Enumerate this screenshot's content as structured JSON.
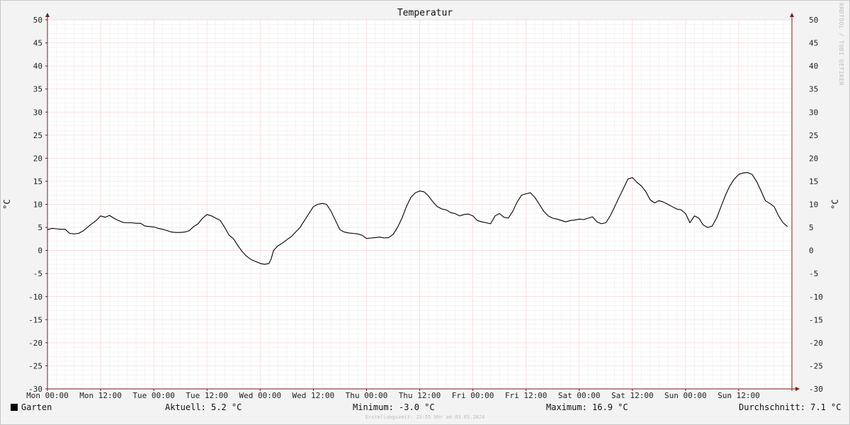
{
  "chart_data": {
    "type": "line",
    "title": "Temperatur",
    "ylabel_left": "°C",
    "ylabel_right": "°C",
    "ylim": [
      -30,
      50
    ],
    "ytick_step": 5,
    "xlim_hours": [
      0,
      168
    ],
    "xtick_labels": [
      "Mon 00:00",
      "Mon 12:00",
      "Tue 00:00",
      "Tue 12:00",
      "Wed 00:00",
      "Wed 12:00",
      "Thu 00:00",
      "Thu 12:00",
      "Fri 00:00",
      "Fri 12:00",
      "Sat 00:00",
      "Sat 12:00",
      "Sun 00:00",
      "Sun 12:00"
    ],
    "grid": true,
    "series": [
      {
        "name": "Garten",
        "color": "#000000",
        "points": [
          [
            0,
            4.5
          ],
          [
            1,
            4.8
          ],
          [
            2,
            4.7
          ],
          [
            3,
            4.6
          ],
          [
            4,
            4.6
          ],
          [
            5,
            3.7
          ],
          [
            6,
            3.6
          ],
          [
            7,
            3.7
          ],
          [
            8,
            4.2
          ],
          [
            9,
            5.0
          ],
          [
            10,
            5.8
          ],
          [
            11,
            6.5
          ],
          [
            12,
            7.5
          ],
          [
            13,
            7.2
          ],
          [
            14,
            7.6
          ],
          [
            15,
            7.0
          ],
          [
            16,
            6.5
          ],
          [
            17,
            6.1
          ],
          [
            18,
            6.0
          ],
          [
            19,
            6.0
          ],
          [
            20,
            5.9
          ],
          [
            21,
            5.9
          ],
          [
            22,
            5.3
          ],
          [
            23,
            5.2
          ],
          [
            24,
            5.1
          ],
          [
            25,
            4.8
          ],
          [
            26,
            4.6
          ],
          [
            27,
            4.3
          ],
          [
            28,
            4.0
          ],
          [
            29,
            3.9
          ],
          [
            30,
            3.9
          ],
          [
            31,
            4.0
          ],
          [
            32,
            4.3
          ],
          [
            33,
            5.2
          ],
          [
            34,
            5.8
          ],
          [
            35,
            7.0
          ],
          [
            36,
            7.8
          ],
          [
            37,
            7.5
          ],
          [
            38,
            7.0
          ],
          [
            39,
            6.5
          ],
          [
            40,
            5.0
          ],
          [
            41,
            3.3
          ],
          [
            42,
            2.5
          ],
          [
            43,
            1.0
          ],
          [
            44,
            -0.3
          ],
          [
            45,
            -1.3
          ],
          [
            46,
            -2.0
          ],
          [
            47,
            -2.4
          ],
          [
            48,
            -2.8
          ],
          [
            49,
            -3.0
          ],
          [
            50,
            -2.8
          ],
          [
            50.5,
            -1.8
          ],
          [
            51,
            0.0
          ],
          [
            52,
            1.0
          ],
          [
            53,
            1.6
          ],
          [
            54,
            2.3
          ],
          [
            55,
            3.0
          ],
          [
            56,
            4.0
          ],
          [
            57,
            5.0
          ],
          [
            58,
            6.5
          ],
          [
            59,
            8.0
          ],
          [
            60,
            9.5
          ],
          [
            61,
            10.0
          ],
          [
            62,
            10.2
          ],
          [
            63,
            10.0
          ],
          [
            64,
            8.5
          ],
          [
            65,
            6.5
          ],
          [
            66,
            4.5
          ],
          [
            67,
            4.0
          ],
          [
            68,
            3.8
          ],
          [
            69,
            3.7
          ],
          [
            70,
            3.6
          ],
          [
            71,
            3.3
          ],
          [
            72,
            2.6
          ],
          [
            73,
            2.7
          ],
          [
            74,
            2.8
          ],
          [
            75,
            2.9
          ],
          [
            76,
            2.7
          ],
          [
            77,
            2.8
          ],
          [
            78,
            3.5
          ],
          [
            79,
            5.0
          ],
          [
            80,
            7.0
          ],
          [
            81,
            9.5
          ],
          [
            82,
            11.5
          ],
          [
            83,
            12.5
          ],
          [
            84,
            12.9
          ],
          [
            85,
            12.7
          ],
          [
            86,
            11.8
          ],
          [
            87,
            10.5
          ],
          [
            88,
            9.5
          ],
          [
            89,
            9.0
          ],
          [
            90,
            8.8
          ],
          [
            91,
            8.2
          ],
          [
            92,
            8.0
          ],
          [
            93,
            7.5
          ],
          [
            94,
            7.8
          ],
          [
            95,
            7.9
          ],
          [
            96,
            7.5
          ],
          [
            97,
            6.5
          ],
          [
            98,
            6.2
          ],
          [
            99,
            6.0
          ],
          [
            100,
            5.8
          ],
          [
            101,
            7.5
          ],
          [
            102,
            8.0
          ],
          [
            103,
            7.2
          ],
          [
            104,
            7.0
          ],
          [
            105,
            8.5
          ],
          [
            106,
            10.5
          ],
          [
            107,
            12.0
          ],
          [
            108,
            12.3
          ],
          [
            109,
            12.5
          ],
          [
            110,
            11.5
          ],
          [
            111,
            10.0
          ],
          [
            112,
            8.5
          ],
          [
            113,
            7.5
          ],
          [
            114,
            7.0
          ],
          [
            115,
            6.8
          ],
          [
            116,
            6.5
          ],
          [
            117,
            6.2
          ],
          [
            118,
            6.5
          ],
          [
            119,
            6.6
          ],
          [
            120,
            6.8
          ],
          [
            121,
            6.7
          ],
          [
            122,
            7.0
          ],
          [
            123,
            7.3
          ],
          [
            124,
            6.2
          ],
          [
            125,
            5.8
          ],
          [
            126,
            6.0
          ],
          [
            127,
            7.5
          ],
          [
            128,
            9.5
          ],
          [
            129,
            11.5
          ],
          [
            130,
            13.5
          ],
          [
            131,
            15.5
          ],
          [
            132,
            15.8
          ],
          [
            133,
            14.8
          ],
          [
            134,
            14.0
          ],
          [
            135,
            12.8
          ],
          [
            136,
            11.0
          ],
          [
            137,
            10.3
          ],
          [
            138,
            10.8
          ],
          [
            139,
            10.5
          ],
          [
            140,
            10.0
          ],
          [
            141,
            9.5
          ],
          [
            142,
            9.0
          ],
          [
            143,
            8.8
          ],
          [
            144,
            8.0
          ],
          [
            145,
            6.0
          ],
          [
            146,
            7.5
          ],
          [
            147,
            7.0
          ],
          [
            148,
            5.5
          ],
          [
            149,
            5.0
          ],
          [
            150,
            5.3
          ],
          [
            151,
            7.0
          ],
          [
            152,
            9.5
          ],
          [
            153,
            12.0
          ],
          [
            154,
            14.0
          ],
          [
            155,
            15.5
          ],
          [
            156,
            16.5
          ],
          [
            157,
            16.8
          ],
          [
            158,
            16.9
          ],
          [
            159,
            16.5
          ],
          [
            160,
            15.0
          ],
          [
            161,
            13.0
          ],
          [
            162,
            10.8
          ],
          [
            163,
            10.2
          ],
          [
            164,
            9.5
          ],
          [
            165,
            7.5
          ],
          [
            166,
            6.0
          ],
          [
            167,
            5.2
          ]
        ]
      }
    ]
  },
  "watermark": "RRDTOOL / TOBI OETIKER",
  "legend": {
    "series_name": "Garten",
    "current": "Aktuell: 5.2 °C",
    "minimum": "Minimum: -3.0 °C",
    "maximum": "Maximum: 16.9 °C",
    "average": "Durchschnitt: 7.1 °C"
  },
  "footer": "Erstellungszeit: 23:55 Uhr am 03.03.2024"
}
